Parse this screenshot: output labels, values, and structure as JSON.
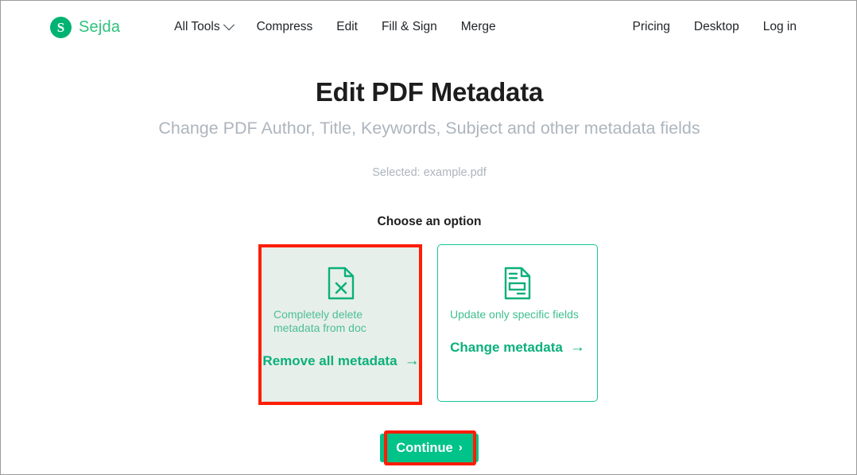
{
  "header": {
    "brand": {
      "mark": "S",
      "name": "Sejda"
    },
    "nav_main": [
      {
        "label": "All Tools",
        "has_chevron": true
      },
      {
        "label": "Compress",
        "has_chevron": false
      },
      {
        "label": "Edit",
        "has_chevron": false
      },
      {
        "label": "Fill & Sign",
        "has_chevron": false
      },
      {
        "label": "Merge",
        "has_chevron": false
      }
    ],
    "nav_right": [
      {
        "label": "Pricing"
      },
      {
        "label": "Desktop"
      },
      {
        "label": "Log in"
      }
    ]
  },
  "main": {
    "title": "Edit PDF Metadata",
    "subtitle": "Change PDF Author, Title, Keywords, Subject and other metadata fields",
    "selected_file": "Selected: example.pdf",
    "choose_label": "Choose an option"
  },
  "options": [
    {
      "icon": "document-x-icon",
      "description": "Completely delete metadata from doc",
      "action": "Remove all metadata",
      "arrow": "→",
      "selected": true
    },
    {
      "icon": "document-fields-icon",
      "description": "Update only specific fields",
      "action": "Change metadata",
      "arrow": "→",
      "selected": false
    }
  ],
  "continue_button": {
    "label": "Continue",
    "caret": "›"
  },
  "colors": {
    "brand_green": "#00b373",
    "accent_green": "#00c389",
    "card_border": "#14c79a",
    "card_selected_bg": "#e7efea",
    "annotation_red": "#fe1d04",
    "muted_text": "#adb5bd",
    "title_text": "#1d1d1d"
  }
}
